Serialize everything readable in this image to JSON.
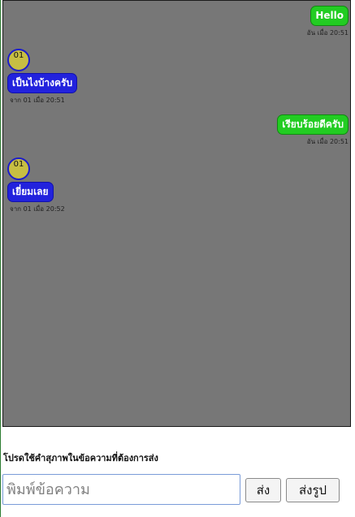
{
  "messages": [
    {
      "direction": "out",
      "text": "Hello",
      "meta": "อัน เมื่อ 20:51"
    },
    {
      "direction": "in",
      "avatar_label": "01",
      "text": "เป็นไงบ้างครับ",
      "meta": "จาก 01 เมื่อ 20:51"
    },
    {
      "direction": "out",
      "text": "เรียบร้อยดีครับ",
      "meta": "อัน เมื่อ 20:51"
    },
    {
      "direction": "in",
      "avatar_label": "01",
      "text": "เยี่ยมเลย",
      "meta": "จาก 01 เมื่อ 20:52"
    }
  ],
  "composer": {
    "notice": "โปรดใช้คำสุภาพในข้อความที่ต้องการส่ง",
    "input_placeholder": "พิมพ์ข้อความ",
    "input_value": "",
    "send_label": "ส่ง",
    "send_image_label": "ส่งรูป"
  },
  "colors": {
    "chat_background": "#777777",
    "outgoing_bubble": "#22cc22",
    "incoming_bubble": "#2222dd",
    "avatar_fill": "#c7be43"
  }
}
